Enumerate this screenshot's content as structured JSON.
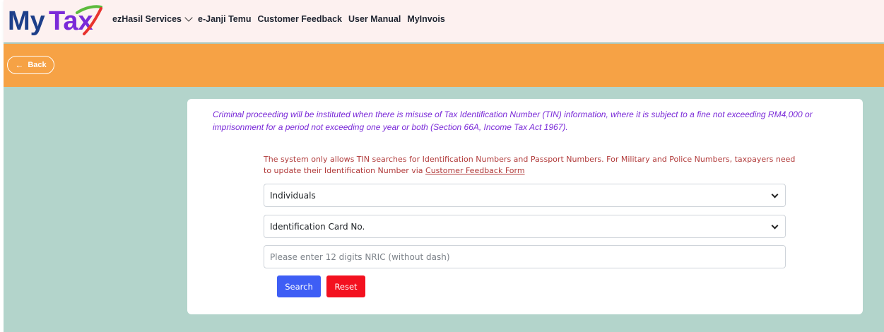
{
  "brand": {
    "logo_text_my": "My",
    "logo_text_tax": "Tax",
    "colors": {
      "my": "#1d3f8a",
      "tax": "#7a2ad8",
      "swoosh_green": "#5cbb3c",
      "swoosh_red": "#e8332e"
    }
  },
  "nav": {
    "items": [
      {
        "label": "ezHasil Services",
        "has_dropdown": true,
        "icon": "chevron-down-icon"
      },
      {
        "label": "e-Janji Temu"
      },
      {
        "label": "Customer Feedback"
      },
      {
        "label": "User Manual"
      },
      {
        "label": "MyInvois"
      }
    ]
  },
  "header_bar": {
    "back_label": "Back",
    "back_icon": "arrow-left-icon",
    "color": "#f6a245"
  },
  "form": {
    "warning": "Criminal proceeding will be instituted when there is misuse of Tax Identification Number (TIN) information, where it is subject to a fine not exceeding RM4,000 or imprisonment for a period not exceeding one year or both (Section 66A, Income Tax Act 1967).",
    "notice_text": "The system only allows TIN searches for Identification Numbers and Passport Numbers. For Military and Police Numbers, taxpayers need to update their Identification Number via ",
    "notice_link": "Customer Feedback Form",
    "taxpayer_type": "Individuals",
    "id_type": "Identification Card No.",
    "id_input": {
      "value": "",
      "placeholder": "Please enter 12 digits NRIC (without dash)"
    },
    "search_label": "Search",
    "reset_label": "Reset"
  },
  "colors": {
    "page_background": "#b3d4cb",
    "search_button": "#3e5ef5",
    "reset_button": "#f3111f",
    "warning_text": "#7a2ad8",
    "notice_text": "#b13a3a"
  }
}
